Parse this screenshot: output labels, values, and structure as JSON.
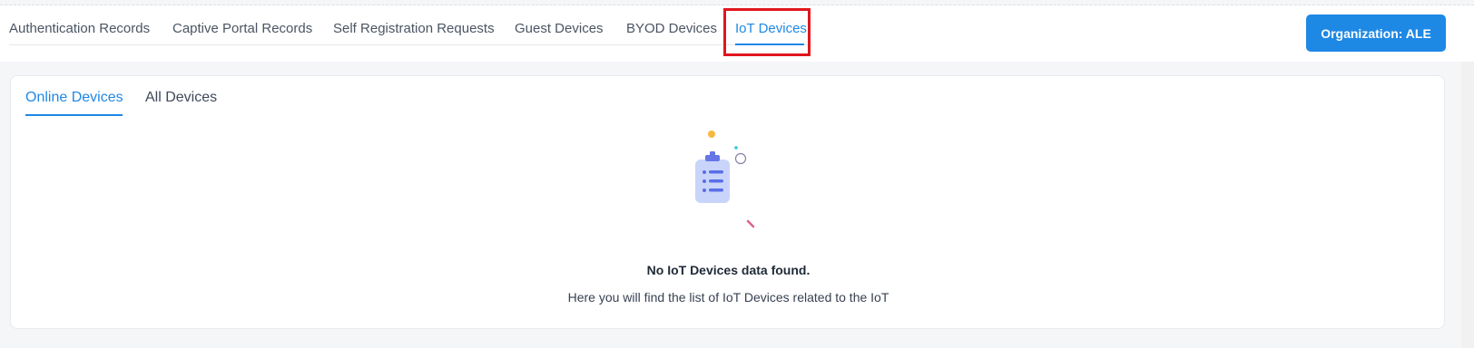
{
  "tabs": [
    {
      "label": "Authentication Records"
    },
    {
      "label": "Captive Portal Records"
    },
    {
      "label": "Self Registration Requests"
    },
    {
      "label": "Guest Devices"
    },
    {
      "label": "BYOD Devices"
    },
    {
      "label": "IoT Devices",
      "active": true
    }
  ],
  "org_button": {
    "label": "Organization: ALE"
  },
  "subtabs": [
    {
      "label": "Online Devices",
      "active": true
    },
    {
      "label": "All Devices"
    }
  ],
  "empty_state": {
    "icon": "clipboard-list-icon",
    "title": "No IoT Devices data found.",
    "description": "Here you will find the list of IoT Devices related to the IoT"
  },
  "colors": {
    "accent": "#1e88e5",
    "highlight": "#e0161d"
  }
}
